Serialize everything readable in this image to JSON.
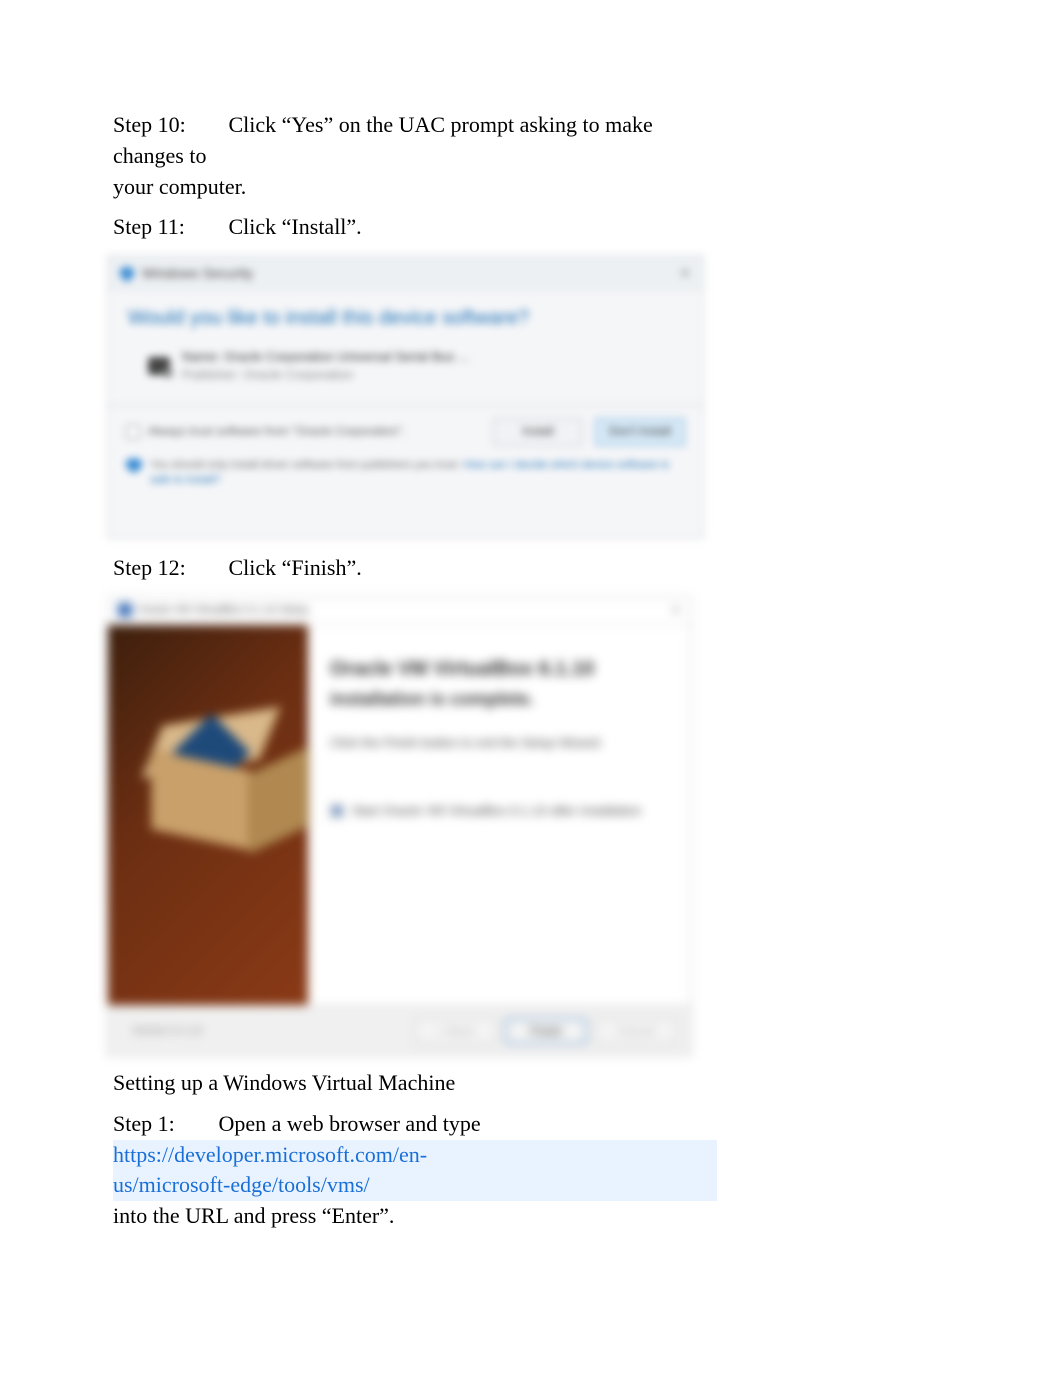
{
  "steps": {
    "s10": {
      "label": "Step 10:",
      "text_line1": "Click “Yes” on the UAC prompt asking to make changes to",
      "text_line2": "your computer."
    },
    "s11": {
      "label": "Step 11:",
      "text": "Click “Install”."
    },
    "s12": {
      "label": "Step 12:",
      "text": "Click “Finish”."
    },
    "section_heading": "Setting up a Windows Virtual Machine",
    "s1": {
      "label": "Step 1:",
      "text_line1": "Open a web browser and type",
      "link": "https://developer.microsoft.com/en-us/microsoft-edge/tools/vms/",
      "text_line3": "into the URL and press “Enter”."
    }
  },
  "dialog1": {
    "title": "Windows Security",
    "close": "✕",
    "question": "Would you like to install this device software?",
    "driver_name": "Name: Oracle Corporation Universal Serial Bus ...",
    "driver_publisher": "Publisher: Oracle Corporation",
    "trust_label": "Always trust software from \"Oracle Corporation\".",
    "install_btn": "Install",
    "dont_install_btn": "Don't Install",
    "hint_text": "You should only install driver software from publishers you trust. ",
    "hint_link": "How can I decide which device software is safe to install?"
  },
  "dialog2": {
    "title": "Oracle VM VirtualBox 6.1.10 Setup",
    "close": "✕",
    "heading": "Oracle VM VirtualBox 6.1.10",
    "subheading": "installation is complete.",
    "instruction": "Click the Finish button to exit the Setup Wizard.",
    "checkbox_label": "Start Oracle VM VirtualBox 6.1.10 after installation",
    "version": "Version 6.1.10",
    "back_btn": "< Back",
    "finish_btn": "Finish",
    "cancel_btn": "Cancel"
  }
}
